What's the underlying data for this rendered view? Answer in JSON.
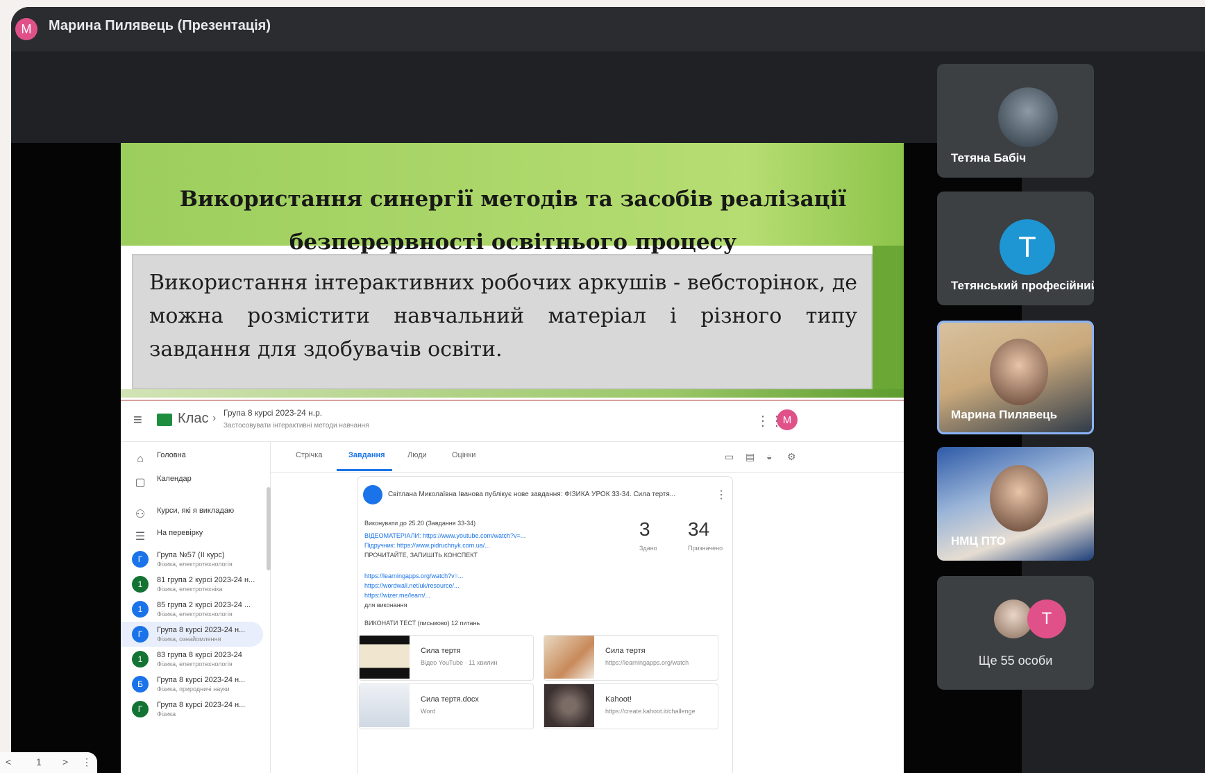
{
  "meeting": {
    "presenter_initial": "M",
    "presenter_title": "Марина Пилявець (Презентація)"
  },
  "slide": {
    "title": "Використання синергії методів та засобів реалізації безперервності освітнього процесу",
    "body": "Використання інтерактивних робочих аркушів - вебсторінок, де можна розмістити навчальний матеріал і різного типу завдання для здобувачів освіти."
  },
  "classroom": {
    "app_name": "Клас",
    "course_title": "Група 8 курсі 2023-24 н.р.",
    "course_subtitle": "Застосовувати інтерактивні методи навчання",
    "user_initial": "M",
    "sidebar": [
      {
        "icon": "home-icon",
        "label": "Головна",
        "sub": ""
      },
      {
        "icon": "calendar-icon",
        "label": "Календар",
        "sub": ""
      },
      {
        "icon": "people-icon",
        "label": "Курси, які я викладаю",
        "sub": ""
      },
      {
        "icon": "checklist-icon",
        "label": "На перевірку",
        "sub": ""
      },
      {
        "initial": "Г",
        "color": "#1a73e8",
        "label": "Група №57 (II курс)",
        "sub": "Фізика, електротехнологія"
      },
      {
        "initial": "1",
        "color": "#137333",
        "label": "81 група 2 курсі 2023-24 н...",
        "sub": "Фізика, електротехніка"
      },
      {
        "initial": "1",
        "color": "#1a73e8",
        "label": "85 група 2 курсі 2023-24 ...",
        "sub": "Фізика, електротехнологія"
      },
      {
        "initial": "Г",
        "color": "#1a73e8",
        "label": "Група 8 курсі 2023-24 н...",
        "sub": "Фізика, ознайомлення"
      },
      {
        "initial": "1",
        "color": "#137333",
        "label": "83 група 8 курсі 2023-24",
        "sub": "Фізика, електротехнологія"
      },
      {
        "initial": "Б",
        "color": "#1a73e8",
        "label": "Група 8 курсі 2023-24 н...",
        "sub": "Фізика, природничі науки"
      },
      {
        "initial": "Г",
        "color": "#137333",
        "label": "Група 8 курсі 2023-24 н...",
        "sub": "Фізика"
      }
    ],
    "tabs": [
      "Стрічка",
      "Завдання",
      "Люди",
      "Оцінки"
    ],
    "post": {
      "header": "Світлана Миколаївна Іванова публікує нове завдання: ФІЗИКА УРОК 33-34. Сила тертя...",
      "lines": [
        {
          "text": "Виконувати до 25.20 (Завдання 33-34)",
          "type": "dark"
        },
        {
          "text": "ВІДЕОМАТЕРІАЛИ: https://www.youtube.com/watch?v=...",
          "type": "link"
        },
        {
          "text": "Підручник: https://www.pidruchnyk.com.ua/...",
          "type": "link"
        },
        {
          "text": "ПРОЧИТАЙТЕ, ЗАПИШІТЬ КОНСПЕКТ",
          "type": "dark"
        },
        {
          "text": "https://learningapps.org/watch?v=...",
          "type": "link"
        },
        {
          "text": "https://wordwall.net/uk/resource/...",
          "type": "link"
        },
        {
          "text": "https://wizer.me/learn/...",
          "type": "link"
        },
        {
          "text": "для виконання",
          "type": "dark"
        },
        {
          "text": "ВИКОНАТИ ТЕСТ (письмово) 12 питань",
          "type": "dark"
        }
      ],
      "stat1_value": "3",
      "stat1_label": "Здано",
      "stat2_value": "34",
      "stat2_label": "Призначено",
      "attachments": [
        {
          "title": "Сила тертя",
          "sub": "Відео YouTube · 11 хвилин"
        },
        {
          "title": "Сила тертя",
          "sub": "https://learningapps.org/watch"
        },
        {
          "title": "Сила тертя.docx",
          "sub": "Word"
        },
        {
          "title": "Kahoot!",
          "sub": "https://create.kahoot.it/challenge"
        }
      ]
    }
  },
  "participants": [
    {
      "name": "Тетяна Бабіч",
      "type": "photo"
    },
    {
      "name": "Тетянський професійний",
      "type": "letter",
      "initial": "T"
    },
    {
      "name": "Марина Пилявець",
      "type": "photo"
    },
    {
      "name": "НМЦ ПТО",
      "type": "photo"
    }
  ],
  "more_participants": {
    "initial": "T",
    "label": "Ще 55 особи"
  },
  "pager": {
    "prev": "<",
    "page": "1",
    "next": ">",
    "menu": "⋮"
  }
}
